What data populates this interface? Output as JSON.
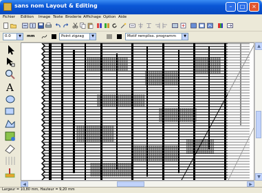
{
  "window": {
    "title": "sans nom   Layout & Editing"
  },
  "menu": [
    "Fichier",
    "Edition",
    "Image",
    "Texte",
    "Broderie",
    "Affichage",
    "Option",
    "Aide"
  ],
  "toolbar2": {
    "size_value": "0.0",
    "unit_label": "mm",
    "stitch_type": "Point zigzag",
    "fill_pattern": "Motif rempliss. programm"
  },
  "status": {
    "text": "Largeur = 10,80 mm, Hauteur = 9,20 mm"
  },
  "colors": {
    "title_blue": "#0a56d6",
    "chrome": "#ece9d8"
  }
}
